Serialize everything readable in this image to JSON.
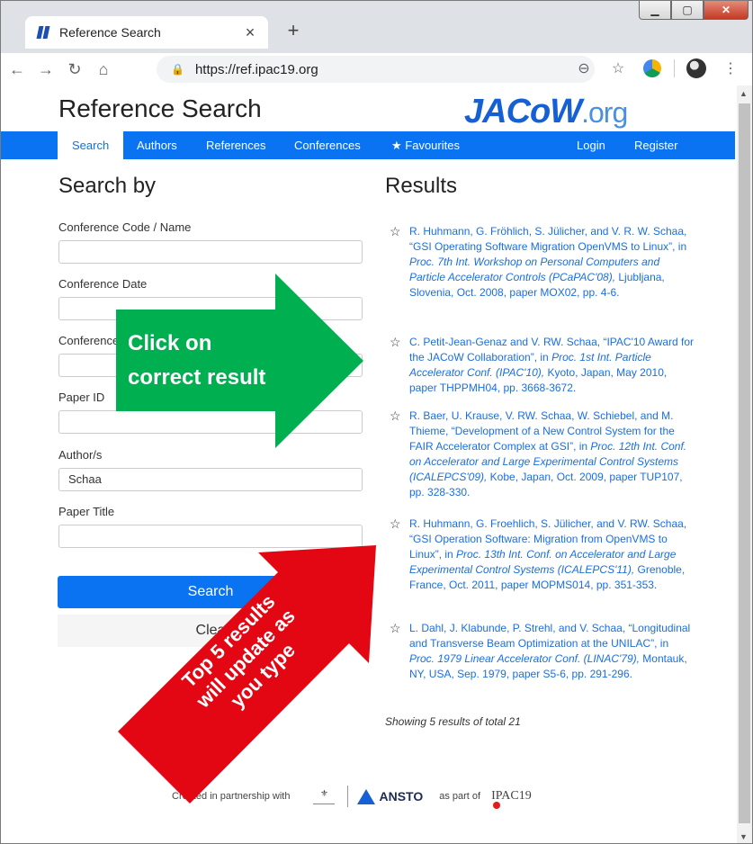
{
  "browser": {
    "tab_title": "Reference Search",
    "url": "https://ref.ipac19.org",
    "new_tab": "+",
    "tab_close": "×"
  },
  "page": {
    "title": "Reference Search",
    "logo_main": "JACoW",
    "logo_suffix": ".org",
    "nav": [
      "Search",
      "Authors",
      "References",
      "Conferences",
      "Favourites",
      "Login",
      "Register"
    ],
    "nav_active": "Search"
  },
  "search": {
    "heading": "Search by",
    "fields": [
      {
        "label": "Conference Code / Name",
        "value": ""
      },
      {
        "label": "Conference Date",
        "value": ""
      },
      {
        "label": "Conference",
        "value": ""
      },
      {
        "label": "Paper ID",
        "value": ""
      },
      {
        "label": "Author/s",
        "value": "Schaa"
      },
      {
        "label": "Paper Title",
        "value": ""
      }
    ],
    "search_button": "Search",
    "clear_button": "Clea"
  },
  "results": {
    "heading": "Results",
    "items": [
      {
        "pre": "R. Huhmann, G. Fröhlich, S. Jülicher, and V. R. W. Schaa, “GSI Operating Software Migration OpenVMS to Linux”, in ",
        "ital": "Proc. 7th Int. Workshop on Personal Computers and Particle Accelerator Controls (PCaPAC'08),",
        "post": " Ljubljana, Slovenia, Oct. 2008, paper MOX02, pp. 4-6."
      },
      {
        "pre": "C. Petit-Jean-Genaz and V. RW. Schaa, “IPAC'10 Award for the JACoW Collaboration”, in ",
        "ital": "Proc. 1st Int. Particle Accelerator Conf. (IPAC'10),",
        "post": " Kyoto, Japan, May 2010, paper THPPMH04, pp. 3668-3672."
      },
      {
        "pre": "R. Baer, U. Krause, V. RW. Schaa, W. Schiebel, and M. Thieme, “Development of a New Control System for the FAIR Accelerator Complex at GSI”, in ",
        "ital": "Proc. 12th Int. Conf. on Accelerator and Large Experimental Control Systems (ICALEPCS'09),",
        "post": " Kobe, Japan, Oct. 2009, paper TUP107, pp. 328-330."
      },
      {
        "pre": "R. Huhmann, G. Froehlich, S. Jülicher, and V. RW. Schaa, “GSI Operation Software: Migration from OpenVMS to Linux”, in ",
        "ital": "Proc. 13th Int. Conf. on Accelerator and Large Experimental Control Systems (ICALEPCS'11),",
        "post": " Grenoble, France, Oct. 2011, paper MOPMS014, pp. 351-353."
      },
      {
        "pre": "L. Dahl, J. Klabunde, P. Strehl, and V. Schaa, “Longitudinal and Transverse Beam Optimization at the UNILAC”, in ",
        "ital": "Proc. 1979 Linear Accelerator Conf. (LINAC'79),",
        "post": " Montauk, NY, USA, Sep. 1979, paper S5-6, pp. 291-296."
      }
    ],
    "showing": "Showing 5 results of total 21"
  },
  "footer": {
    "created": "Created in partnership with",
    "ansto": "ANSTO",
    "part_of": "as part of",
    "ipac": "IPAC19"
  },
  "annotations": {
    "green_line1": "Click on",
    "green_line2": "correct result",
    "red_line1": "Top 5 results",
    "red_line2": "will update as",
    "red_line3": "you type",
    "green_color": "#00b050",
    "red_color": "#e00000"
  }
}
